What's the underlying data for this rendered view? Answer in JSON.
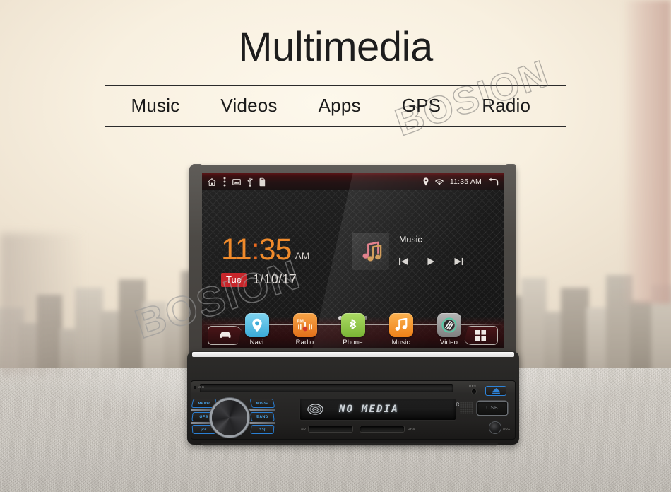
{
  "page": {
    "title": "Multimedia",
    "nav": [
      {
        "label": "Music"
      },
      {
        "label": "Videos"
      },
      {
        "label": "Apps"
      },
      {
        "label": "GPS"
      },
      {
        "label": "Radio"
      }
    ],
    "watermark": "BOSION"
  },
  "device": {
    "screen": {
      "status_bar": {
        "icons_left": [
          "home-icon",
          "menu-dots-icon",
          "screenshot-icon",
          "usb-icon",
          "sdcard-icon"
        ],
        "icons_right": [
          "location-pin-icon",
          "wifi-icon"
        ],
        "time": "11:35 AM",
        "back_icon": "back-arrow-icon"
      },
      "clock_widget": {
        "hours": "11",
        "colon": ":",
        "minutes": "35",
        "ampm": "AM",
        "day": "Tue",
        "date": "1/10/17"
      },
      "music_widget": {
        "title": "Music",
        "album_art_icon": "music-note-icon",
        "prev_icon": "skip-previous-icon",
        "play_icon": "play-icon",
        "next_icon": "skip-next-icon"
      },
      "page_dots": {
        "count": 4,
        "active_index": 0
      },
      "dock": {
        "car_button_icon": "car-icon",
        "apps_button_icon": "app-grid-icon",
        "apps": [
          {
            "label": "Navi",
            "icon": "location-pin-icon",
            "color": "#5ec3e8"
          },
          {
            "label": "Radio",
            "icon": "fm-radio-icon",
            "color": "#f28a22"
          },
          {
            "label": "Phone",
            "icon": "bluetooth-icon",
            "color": "#8ec63f"
          },
          {
            "label": "Music",
            "icon": "music-note-icon",
            "color": "#f59324"
          },
          {
            "label": "Video",
            "icon": "video-disc-icon",
            "color": "#9a9a9a"
          }
        ]
      }
    },
    "panel": {
      "mic_label": "MIC",
      "res_label": "RES",
      "eject_icon": "eject-icon",
      "left_buttons": [
        {
          "label": "MENU"
        },
        {
          "label": "GPS"
        },
        {
          "label": "|<<"
        }
      ],
      "right_buttons": [
        {
          "label": "MODE"
        },
        {
          "label": "BAND"
        },
        {
          "label": ">>|"
        }
      ],
      "knob_name": "volume-knob",
      "lcd": {
        "disc_icon": "disc-icon",
        "text": "NO MEDIA"
      },
      "sd_label": "SD",
      "gps_label": "GPS",
      "ir_label": "R",
      "usb_label": "USB",
      "aux_label": "AUX"
    }
  },
  "colors": {
    "accent_orange": "#ef8a2b",
    "day_badge_red": "#c8262b",
    "button_blue": "#2a7fd4",
    "lcd_text": "#cfd4d8"
  }
}
